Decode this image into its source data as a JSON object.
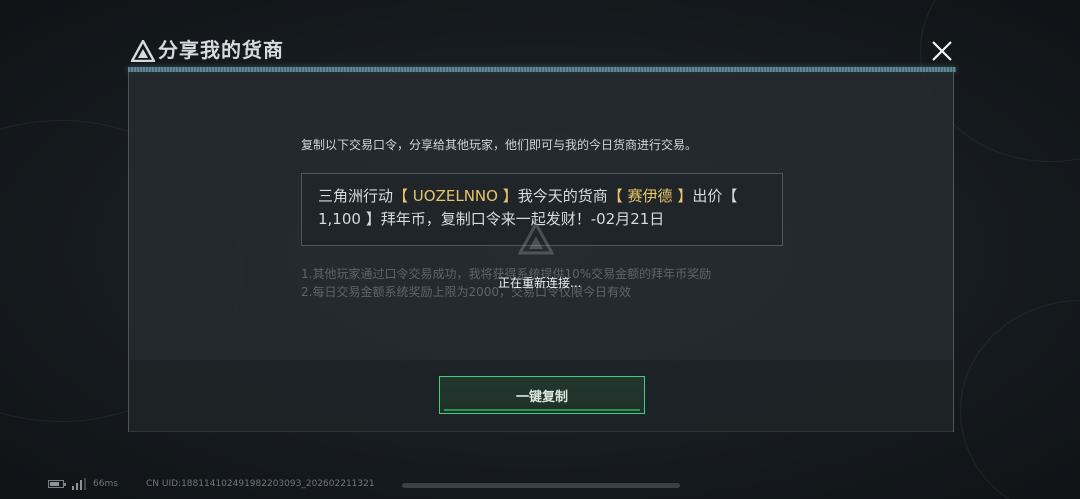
{
  "dialog": {
    "title": "分享我的货商",
    "instruction": "复制以下交易口令，分享给其他玩家，他们即可与我的今日货商进行交易。",
    "code": {
      "part1": "三角洲行动",
      "code_open": "【 ",
      "trade_code": "UOZELNNO",
      "code_close": " 】",
      "part2": "我今天的货商",
      "trader_open": "【 ",
      "trader_name": "赛伊德",
      "trader_close": " 】",
      "part3": "出价【 1,100 】拜年币，复制口令来一起发财！-02月21日"
    },
    "notes": [
      "1.其他玩家通过口令交易成功，我将获得系统提供10%交易金额的拜年币奖励",
      "2.每日交易金额系统奖励上限为2000，交易口令仅限今日有效"
    ],
    "reconnect_text": "正在重新连接...",
    "copy_button_label": "一键复制"
  },
  "status_bar": {
    "ping": "66ms",
    "uid": "CN UID:18811410249198220309З_202602211321"
  },
  "colors": {
    "accent_green": "#3fcf77",
    "highlight_gold": "#e9c46a"
  }
}
